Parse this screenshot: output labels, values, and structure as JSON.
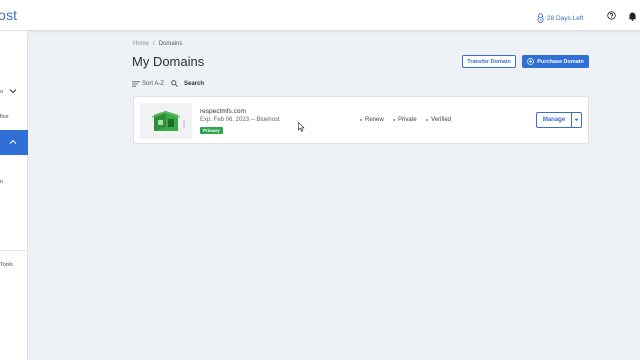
{
  "header": {
    "brand": "ost",
    "trial_label": "28 Days Left",
    "icons": [
      "lock-icon",
      "help-icon",
      "bell-icon"
    ]
  },
  "sidebar": {
    "items": [
      {
        "label": "o"
      },
      {
        "label": "fice"
      },
      {
        "label": "n"
      },
      {
        "label": "Tools"
      }
    ],
    "accent_color": "#2f6fd6"
  },
  "breadcrumb": {
    "home": "Home",
    "separator": "/",
    "current": "Domains"
  },
  "page": {
    "title": "My Domains",
    "transfer_button": "Transfer Domain",
    "purchase_button": "Purchase Domain"
  },
  "toolbar": {
    "sort_label": "Sort A-Z",
    "search_label": "Search"
  },
  "domains": [
    {
      "name": "respectmfs.com",
      "expiry": "Exp. Feb 06, 2023 -- Bluehost",
      "badge": "Primary",
      "attributes": [
        "Renew",
        "Private",
        "Verified"
      ],
      "manage_label": "Manage"
    }
  ],
  "colors": {
    "brand_blue": "#2f6fd6",
    "primary_badge": "#2ea44f",
    "background": "#eef1f5"
  }
}
